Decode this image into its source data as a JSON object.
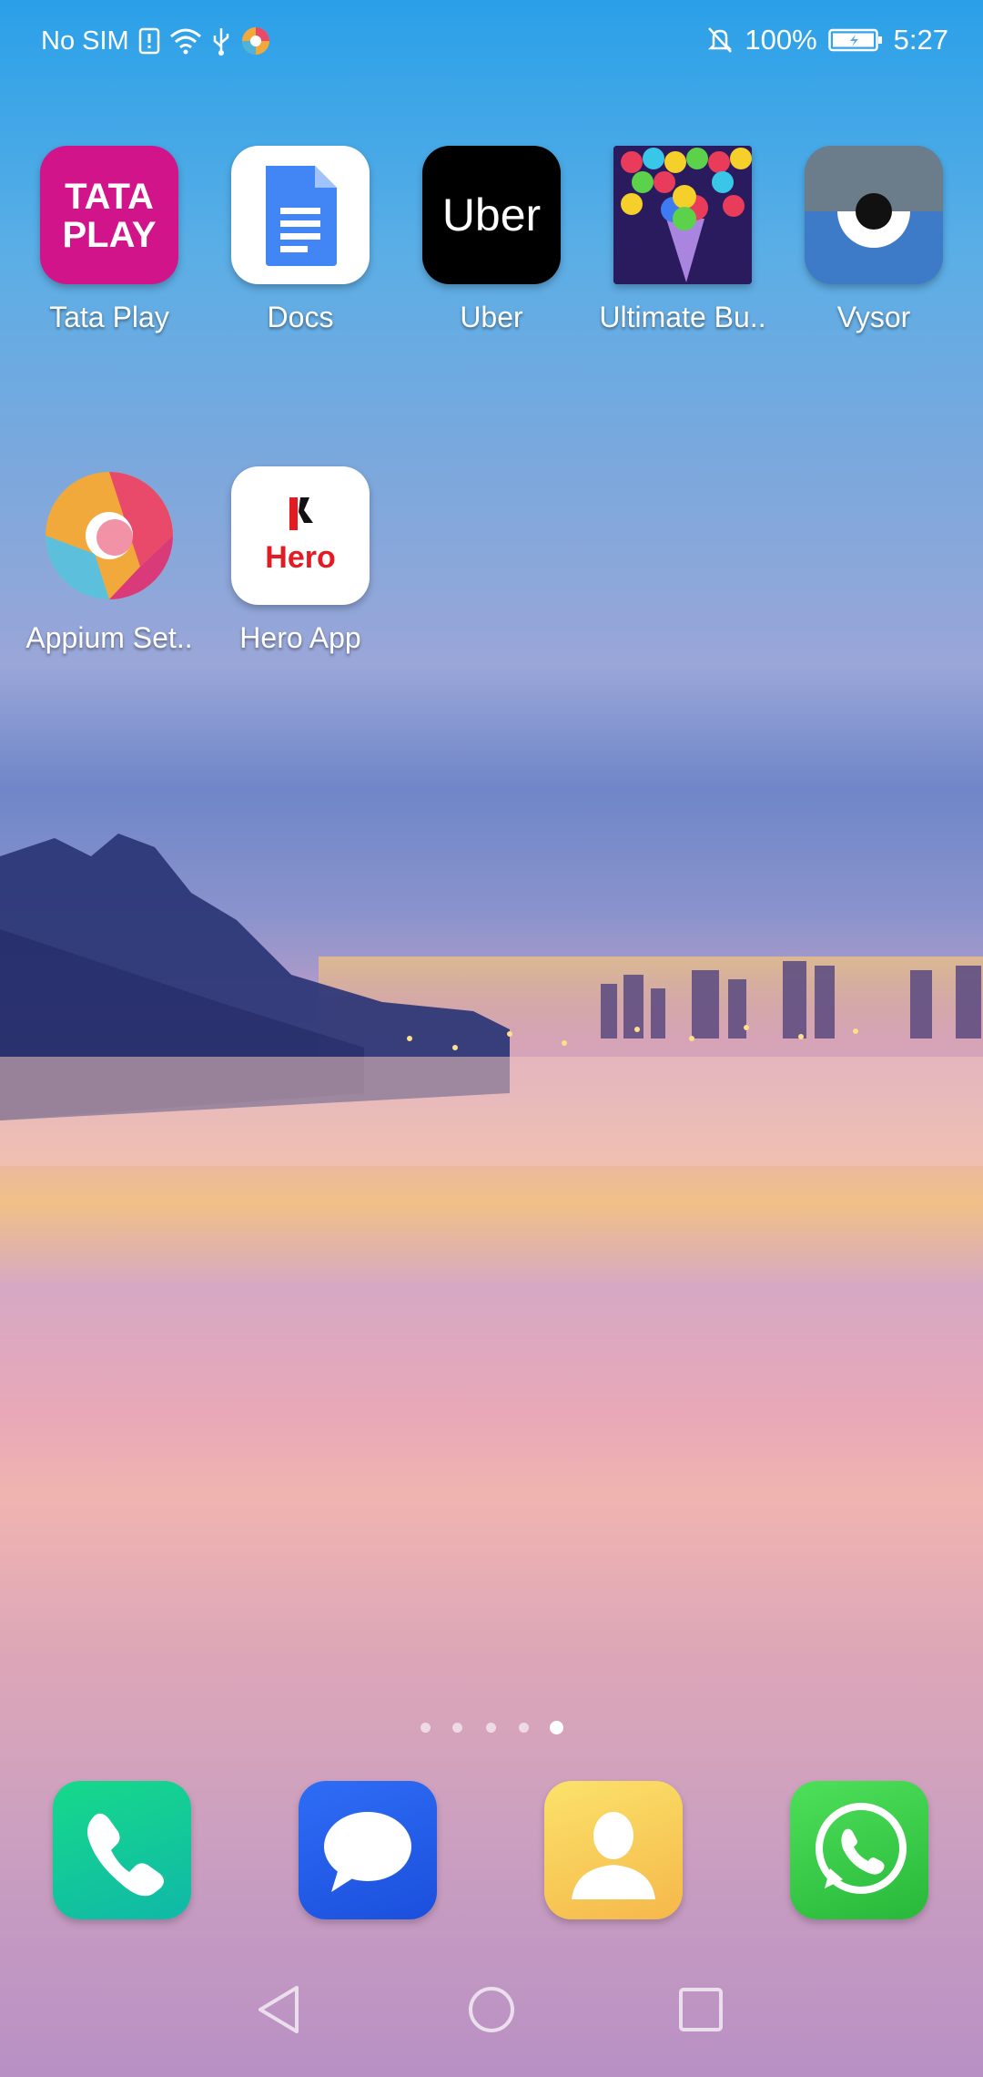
{
  "status_bar": {
    "carrier": "No SIM",
    "battery": "100%",
    "time": "5:27"
  },
  "apps": [
    {
      "label": "Tata Play",
      "icon": "tata-play-icon",
      "icon_text_1": "TATA",
      "icon_text_2": "PLAY"
    },
    {
      "label": "Docs",
      "icon": "google-docs-icon"
    },
    {
      "label": "Uber",
      "icon": "uber-icon",
      "icon_text": "Uber"
    },
    {
      "label": "Ultimate Bu..",
      "icon": "bubble-shooter-icon"
    },
    {
      "label": "Vysor",
      "icon": "vysor-icon"
    },
    {
      "label": "Appium Set..",
      "icon": "appium-icon"
    },
    {
      "label": "Hero App",
      "icon": "hero-app-icon",
      "icon_text": "Hero"
    }
  ],
  "page_indicator": {
    "pages": 5,
    "current": 5
  },
  "dock": [
    {
      "icon": "phone-icon"
    },
    {
      "icon": "messages-icon"
    },
    {
      "icon": "contacts-icon"
    },
    {
      "icon": "whatsapp-icon"
    }
  ],
  "navbar": [
    "back-button",
    "home-button",
    "recents-button"
  ],
  "colors": {
    "tata_play": "#d2148b",
    "docs_blue": "#4285f4",
    "uber_black": "#000000",
    "vysor_blue": "#3d7ac7",
    "hero_red": "#e31b23",
    "phone_green": "#16c98a",
    "messages_blue": "#1e5ef0",
    "contacts_yellow": "#f7d24a",
    "whatsapp_green": "#3ccf4e"
  }
}
